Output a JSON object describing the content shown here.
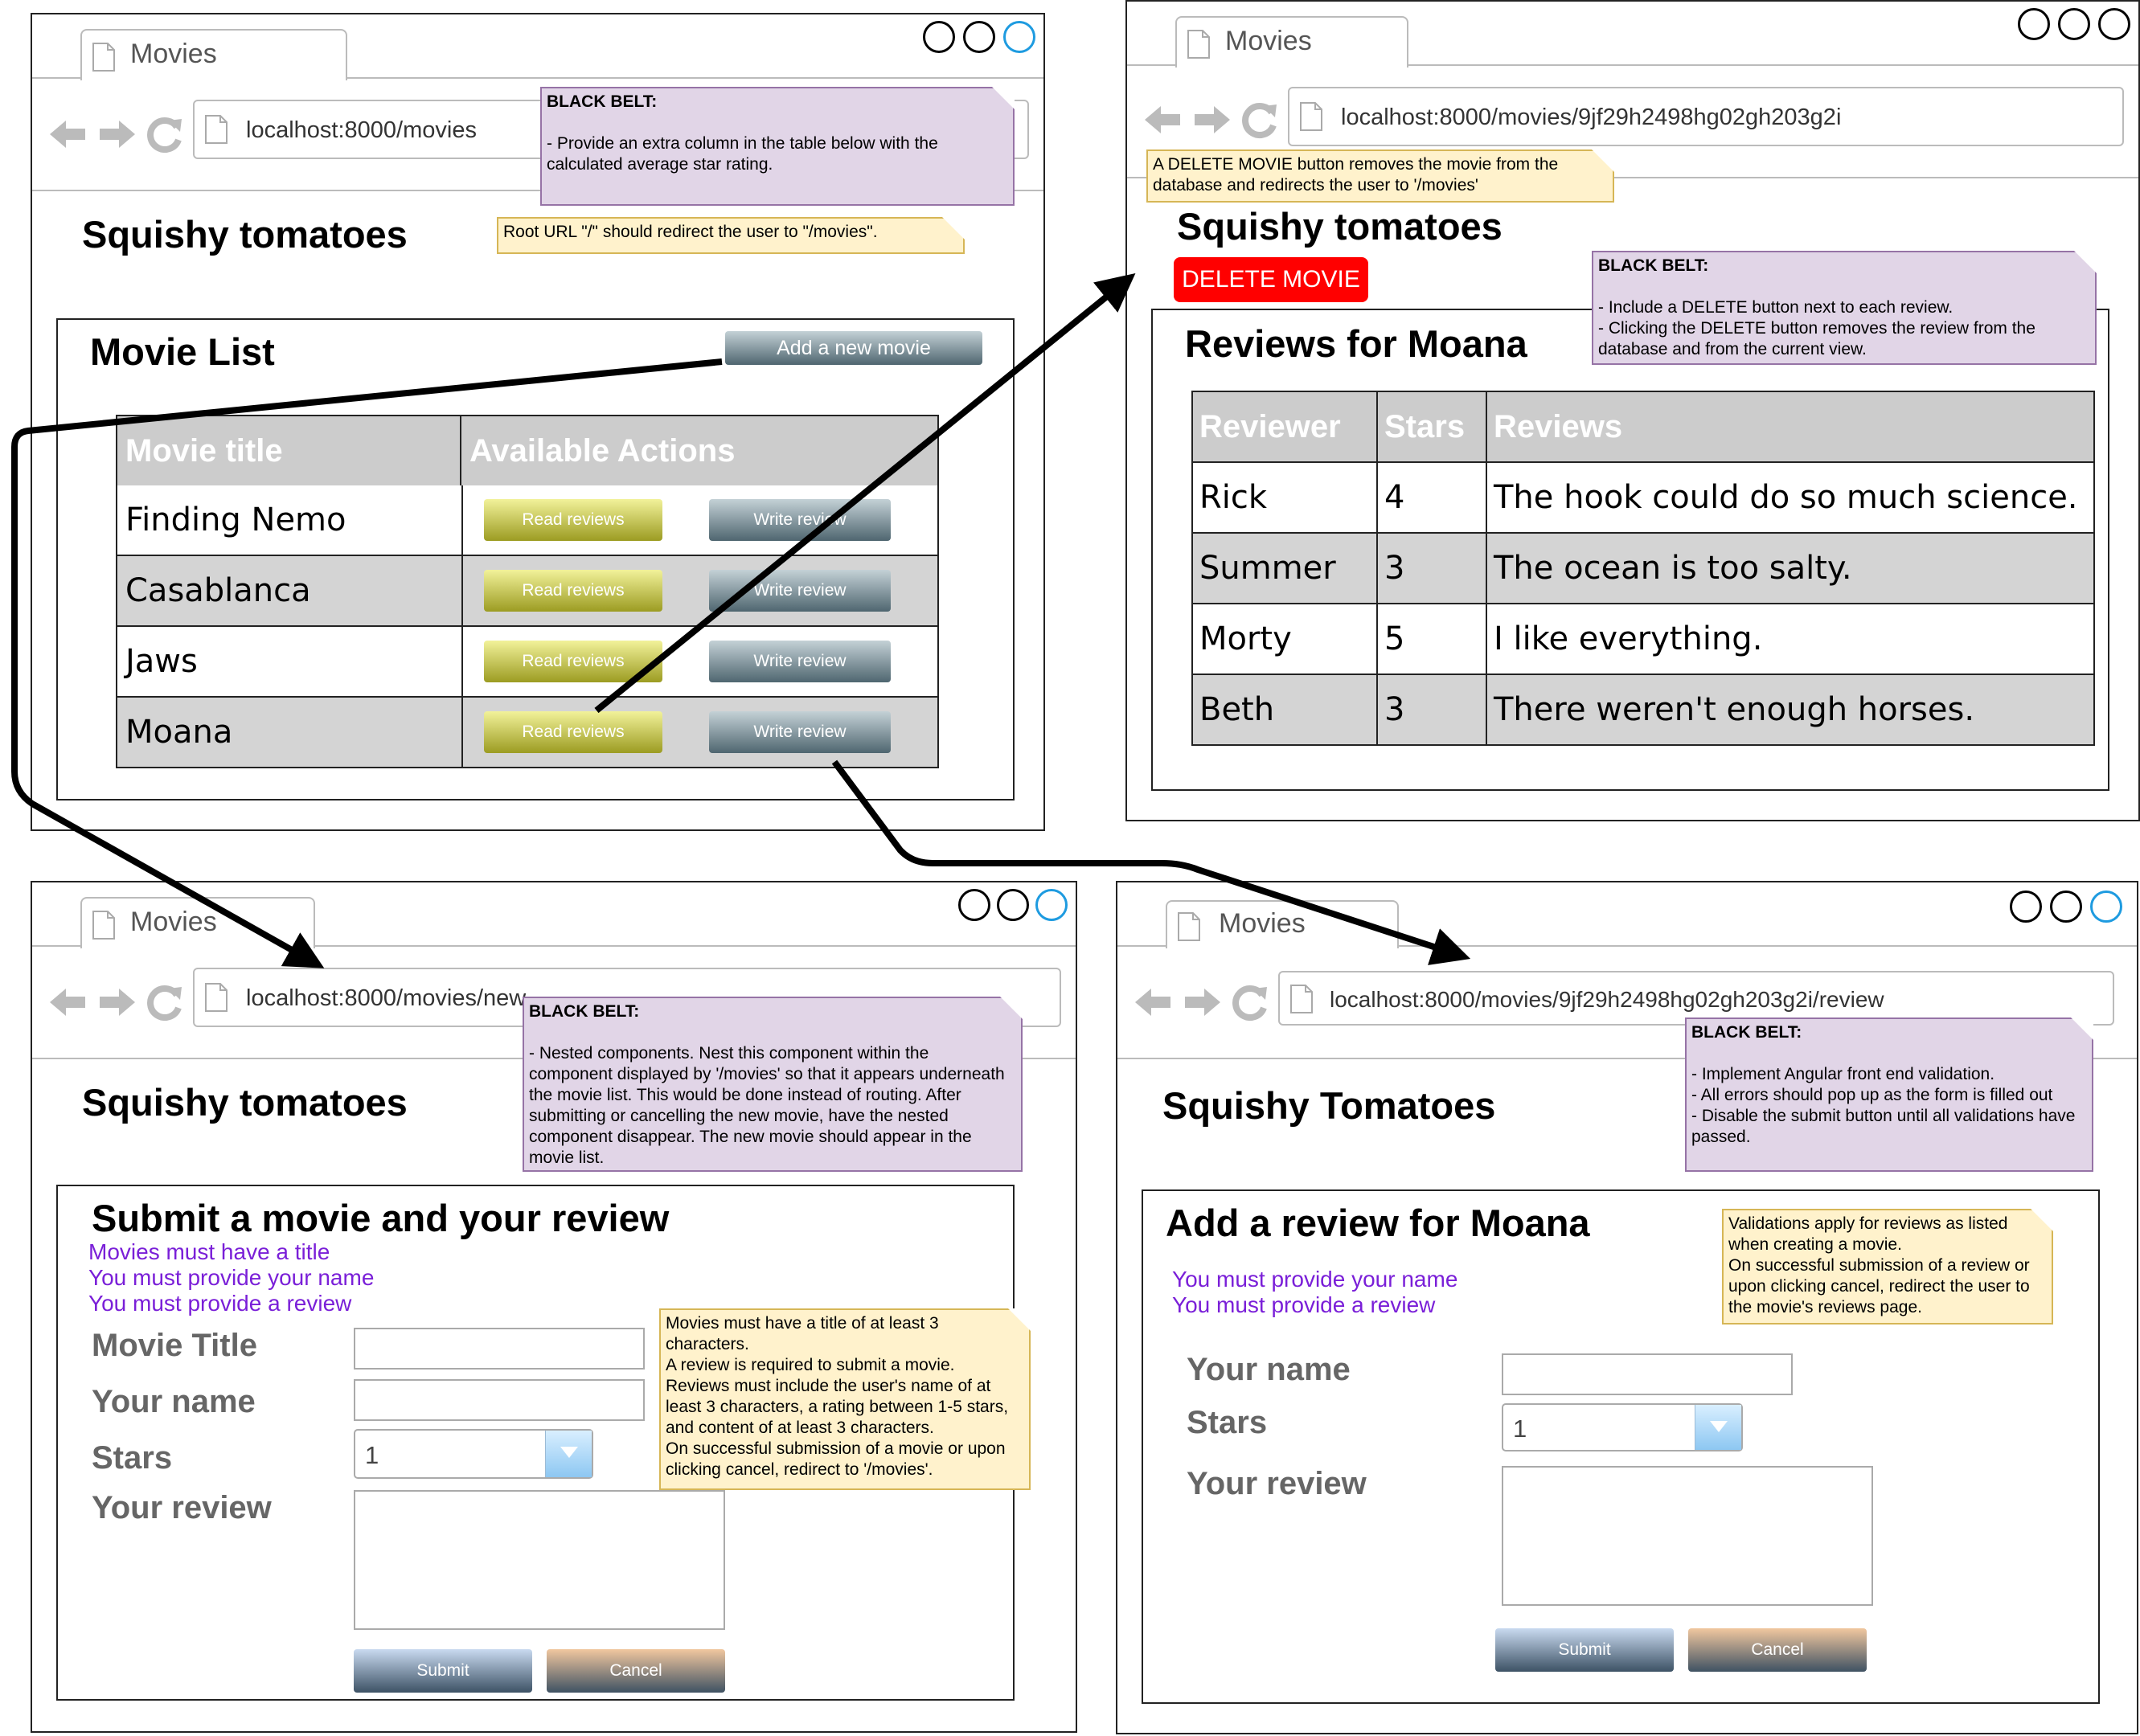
{
  "colors": {
    "note_purple_fill": "#e1d5e7",
    "note_purple_border": "#9673a6",
    "note_yellow_fill": "#fff2cc",
    "note_yellow_border": "#d6b656",
    "error_text": "#7a1fd8",
    "delete_button": "#ff0000",
    "table_header": "#cccccc",
    "row_shade": "#d4d4d4",
    "window_control_accent": "#1e9be0"
  },
  "windows": {
    "movie_list": {
      "tab_title": "Movies",
      "url": "localhost:8000/movies",
      "site_title": "Squishy tomatoes",
      "panel_title": "Movie List",
      "add_button": "Add a new movie",
      "headers": [
        "Movie title",
        "Available Actions"
      ],
      "rows": [
        {
          "title": "Finding Nemo",
          "read": "Read reviews",
          "write": "Write review"
        },
        {
          "title": "Casablanca",
          "read": "Read reviews",
          "write": "Write review"
        },
        {
          "title": "Jaws",
          "read": "Read reviews",
          "write": "Write review"
        },
        {
          "title": "Moana",
          "read": "Read reviews",
          "write": "Write review"
        }
      ],
      "note_black_belt": {
        "title": "BLACK BELT:",
        "body": "- Provide an extra column in the table below with the calculated average star rating."
      },
      "note_root": "Root URL \"/\" should redirect the user to \"/movies\"."
    },
    "movie_reviews": {
      "tab_title": "Movies",
      "url": "localhost:8000/movies/9jf29h2498hg02gh203g2i",
      "site_title": "Squishy tomatoes",
      "delete_movie_button": "DELETE MOVIE",
      "panel_title": "Reviews for Moana",
      "headers": [
        "Reviewer",
        "Stars",
        "Reviews"
      ],
      "rows": [
        {
          "reviewer": "Rick",
          "stars": "4",
          "review": "The hook could do so much science."
        },
        {
          "reviewer": "Summer",
          "stars": "3",
          "review": "The ocean is too salty."
        },
        {
          "reviewer": "Morty",
          "stars": "5",
          "review": "I like everything."
        },
        {
          "reviewer": "Beth",
          "stars": "3",
          "review": "There weren't enough horses."
        }
      ],
      "note_delete": "A DELETE MOVIE button removes the movie from the database and redirects the user to '/movies'",
      "note_black_belt": {
        "title": "BLACK BELT:",
        "body": "- Include a DELETE button next to each review.\n- Clicking the DELETE button removes the review from the database and from the current view."
      }
    },
    "new_movie": {
      "tab_title": "Movies",
      "url": "localhost:8000/movies/new",
      "site_title": "Squishy tomatoes",
      "panel_title": "Submit a movie and your review",
      "errors": [
        "Movies must have a title",
        "You must provide your name",
        "You must provide a review"
      ],
      "labels": {
        "movie_title": "Movie Title",
        "name": "Your name",
        "stars": "Stars",
        "review": "Your review"
      },
      "stars_value": "1",
      "submit": "Submit",
      "cancel": "Cancel",
      "note_black_belt": {
        "title": "BLACK BELT:",
        "body": "- Nested components. Nest this component within the component displayed by '/movies' so that it appears underneath the movie list. This would be done instead of routing. After submitting or cancelling the new movie, have the nested component disappear. The new movie should appear in the movie list."
      },
      "note_validation": "Movies must have a title of at least 3 characters.\nA review is required to submit a movie.\nReviews must include the user's name of at least 3 characters, a rating between 1-5 stars, and content of at least 3 characters.\nOn successful submission of a movie or upon clicking cancel, redirect to '/movies'."
    },
    "new_review": {
      "tab_title": "Movies",
      "url": "localhost:8000/movies/9jf29h2498hg02gh203g2i/review",
      "site_title": "Squishy Tomatoes",
      "panel_title": "Add a review for Moana",
      "errors": [
        "You must provide your name",
        "You must provide a review"
      ],
      "labels": {
        "name": "Your name",
        "stars": "Stars",
        "review": "Your review"
      },
      "stars_value": "1",
      "submit": "Submit",
      "cancel": "Cancel",
      "note_black_belt": {
        "title": "BLACK BELT:",
        "body": "- Implement Angular front end validation.\n- All errors should pop up as the form is filled out\n- Disable the submit button until all validations have passed."
      },
      "note_validation": "Validations apply for reviews as listed when creating a movie.\nOn successful submission of a review or upon clicking cancel, redirect the user to the movie's reviews page."
    }
  }
}
